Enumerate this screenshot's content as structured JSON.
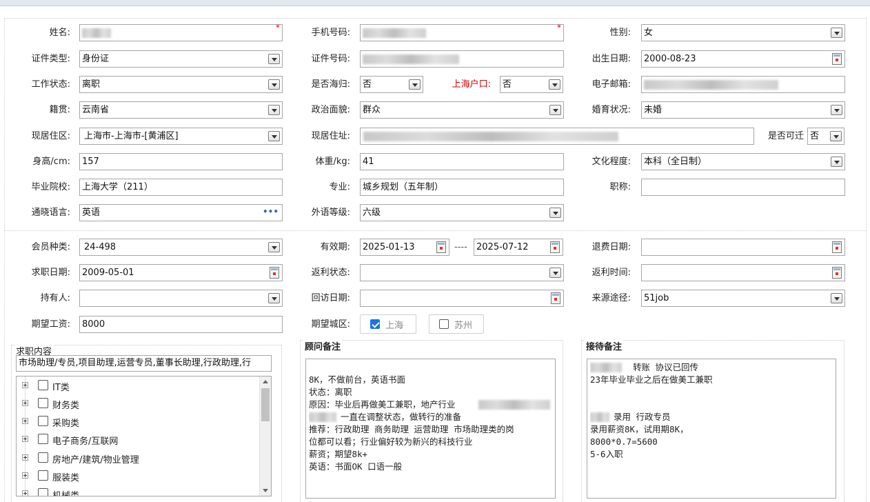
{
  "profile": {
    "name_label": "姓名:",
    "phone_label": "手机号码:",
    "gender_label": "性别:",
    "gender_value": "女",
    "id_type_label": "证件类型:",
    "id_type_value": "身份证",
    "id_no_label": "证件号码:",
    "birth_label": "出生日期:",
    "birth_value": "2000-08-23",
    "work_status_label": "工作状态:",
    "work_status_value": "离职",
    "overseas_label": "是否海归:",
    "overseas_value": "否",
    "sh_hukou_label": "上海户口:",
    "sh_hukou_value": "否",
    "email_label": "电子邮箱:",
    "native_label": "籍贯:",
    "native_value": "云南省",
    "political_label": "政治面貌:",
    "political_value": "群众",
    "marital_label": "婚育状况:",
    "marital_value": "未婚",
    "district_label": "现居住区:",
    "district_value": "上海市-上海市-[黄浦区]",
    "address_label": "现居住址:",
    "relocate_label": "是否可迁",
    "relocate_value": "否",
    "height_label": "身高/cm:",
    "height_value": "157",
    "weight_label": "体重/kg:",
    "weight_value": "41",
    "education_label": "文化程度:",
    "education_value": "本科（全日制）",
    "school_label": "毕业院校:",
    "school_value": "上海大学（211）",
    "major_label": "专业:",
    "major_value": "城乡规划（五年制）",
    "title_label": "职称:",
    "language_label": "通晓语言:",
    "language_value": "英语",
    "lang_level_label": "外语等级:",
    "lang_level_value": "六级"
  },
  "membership": {
    "member_type_label": "会员种类:",
    "member_type_value": "24-498",
    "valid_label": "有效期:",
    "valid_from": "2025-01-13",
    "valid_sep": "----",
    "valid_to": "2025-07-12",
    "refund_date_label": "退费日期:",
    "job_date_label": "求职日期:",
    "job_date_value": "2009-05-01",
    "rebate_status_label": "返利状态:",
    "rebate_time_label": "返利时间:",
    "holder_label": "持有人:",
    "revisit_label": "回访日期:",
    "source_label": "来源途径:",
    "source_value": "51job",
    "salary_label": "期望工资:",
    "salary_value": "8000",
    "city_label": "期望城区:",
    "city_options": [
      {
        "label": "上海",
        "checked": true
      },
      {
        "label": "苏州",
        "checked": false
      }
    ]
  },
  "job_content": {
    "title": "求职内容",
    "summary": "市场助理/专员,项目助理,运营专员,董事长助理,行政助理,行",
    "tree": [
      "IT类",
      "财务类",
      "采购类",
      "电子商务/互联网",
      "房地产/建筑/物业管理",
      "服装类",
      "机械类"
    ]
  },
  "advisor_notes": {
    "title": "顾问备注",
    "lines": [
      "",
      "8K，不做前台，英语书面",
      "状态：离职",
      "原因：毕业后再做美工兼职，地产行业",
      "一直在调整状态，做转行的准备",
      "推荐：行政助理  商务助理 运营助理  市场助理类的岗",
      "位都可以看；行业偏好较为新兴的科技行业",
      "薪资；期望8k+",
      "英语：书面OK 口语一般"
    ]
  },
  "reception_notes": {
    "title": "接待备注",
    "lines": [
      "转账  协议已回传",
      "23年毕业毕业之后在做美工兼职",
      "",
      "",
      "录用  行政专员",
      "录用薪资8K，试用期8K，",
      "8000*0.7=5600",
      "5-6入职"
    ]
  }
}
